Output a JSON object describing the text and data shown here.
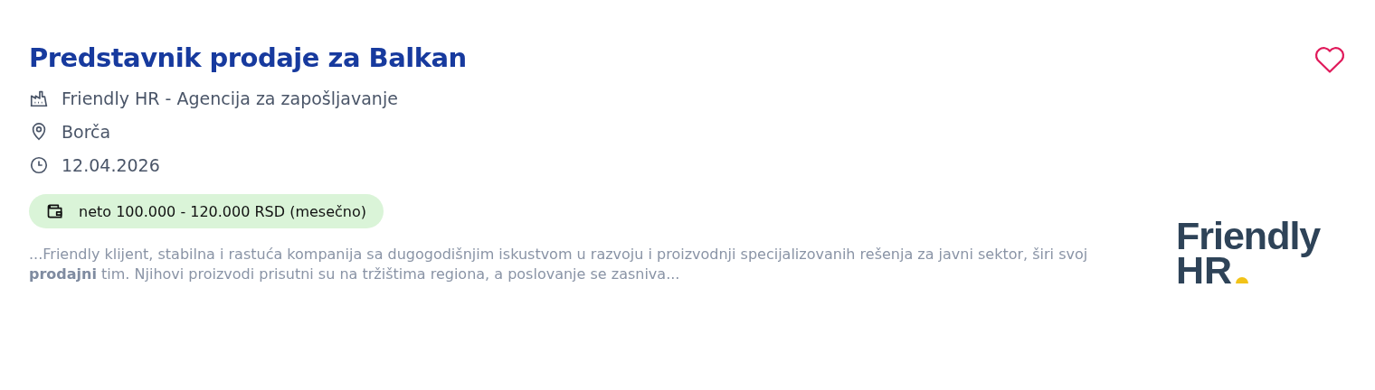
{
  "job": {
    "title": "Predstavnik prodaje za Balkan",
    "saved": false,
    "meta": [
      {
        "kind": "company",
        "text": "Friendly HR - Agencija za zapošljavanje"
      },
      {
        "kind": "location",
        "text": "Borča"
      },
      {
        "kind": "date",
        "text": "12.04.2026"
      }
    ],
    "salary": "neto 100.000 - 120.000 RSD (mesečno)",
    "description": "...Friendly klijent, stabilna i rastuća kompanija sa dugogodišnjim iskustvom u razvoju i proizvodnji specijalizovanih rešenja za javni sektor, širi svoj **prodajni** tim. Njihovi proizvodi prisutni su na tržištima regiona, a poslovanje se zasniva...",
    "logo": [
      "Friendly",
      "HR"
    ]
  }
}
